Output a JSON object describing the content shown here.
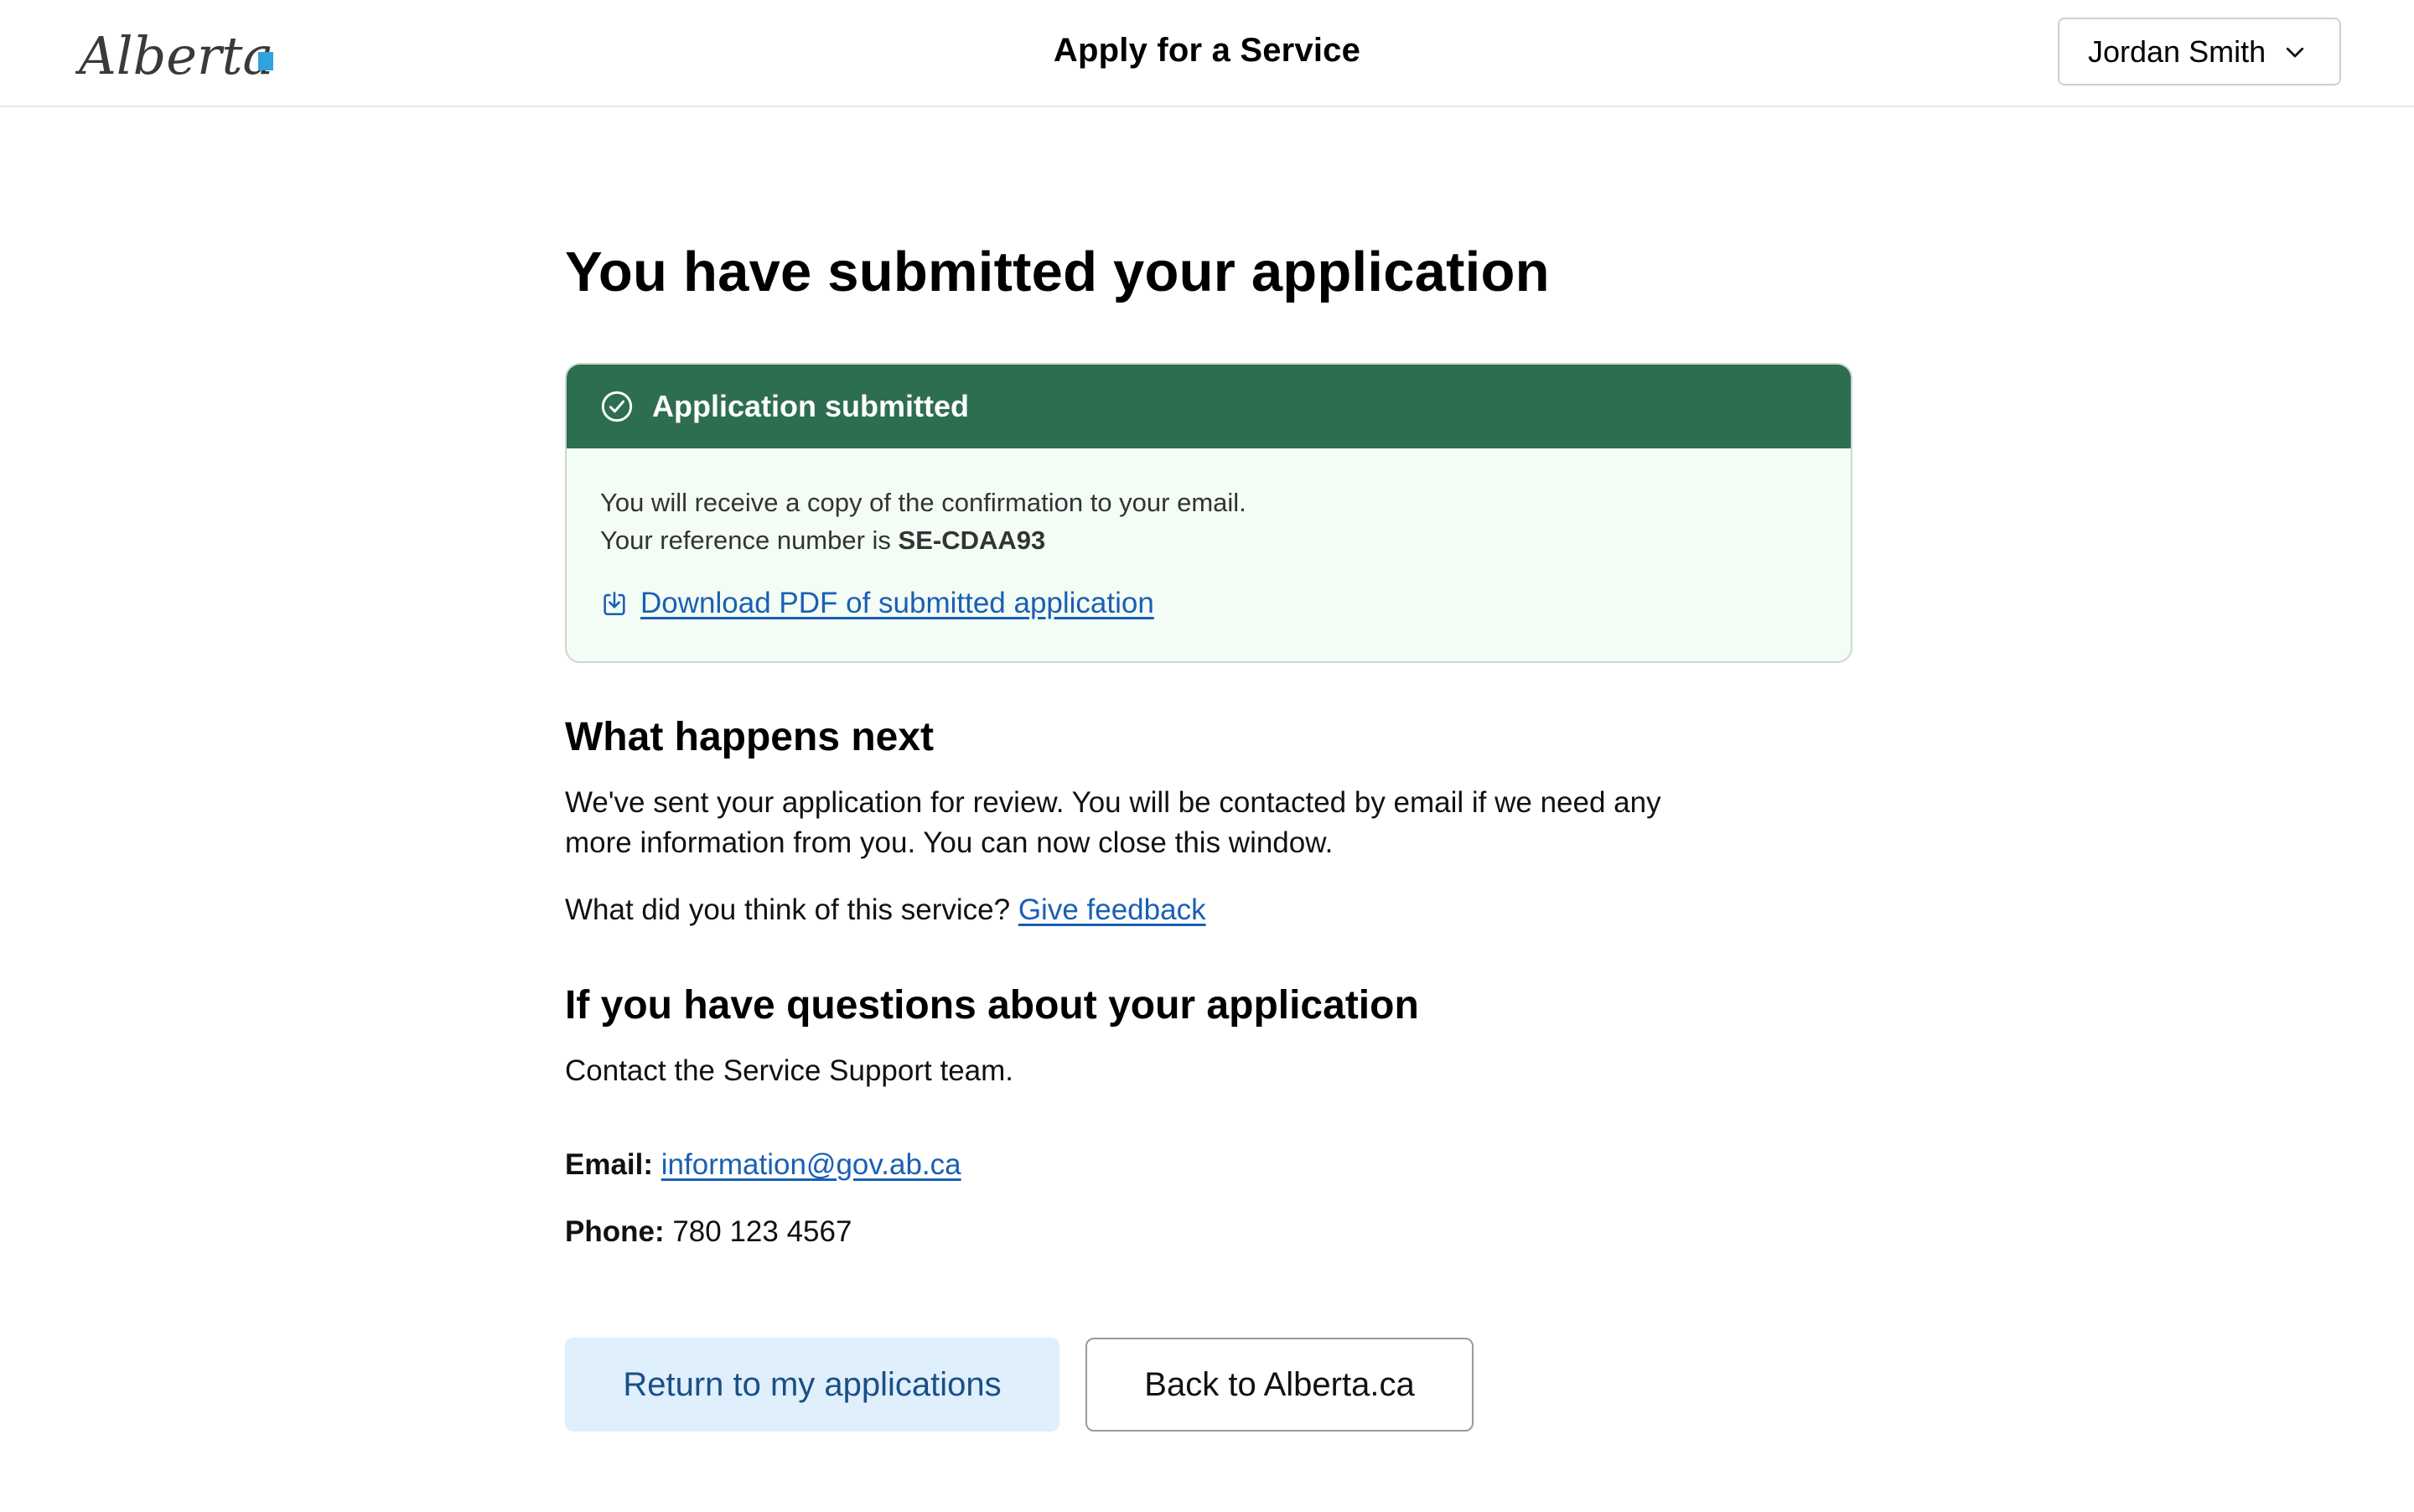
{
  "header": {
    "logo_text": "Alberta",
    "app_title": "Apply for a Service",
    "user_name": "Jordan Smith"
  },
  "main": {
    "title": "You have submitted your application",
    "callout": {
      "heading": "Application submitted",
      "line1": "You will receive a copy of the confirmation to your email.",
      "line2_prefix": "Your reference number is ",
      "reference": "SE-CDAA93",
      "download_label": "Download PDF of submitted application"
    },
    "next": {
      "heading": "What happens next",
      "body": "We've sent your application for review. You will be contacted by email if we need any more information from you. You can now close this window.",
      "feedback_prompt": "What did you think of this service?",
      "feedback_link": "Give feedback"
    },
    "questions": {
      "heading": "If you have questions about your application",
      "body": "Contact the Service Support team.",
      "email_label": "Email:",
      "email_value": "information@gov.ab.ca",
      "phone_label": "Phone:",
      "phone_value": "780 123 4567"
    },
    "buttons": {
      "primary": "Return to my applications",
      "secondary": "Back to Alberta.ca"
    }
  },
  "colors": {
    "callout_header": "#2d6e51",
    "callout_bg": "#f3fcf5",
    "link": "#1a5fb4",
    "primary_button_bg": "#dfeffc",
    "logo_accent": "#2ea3e0"
  }
}
